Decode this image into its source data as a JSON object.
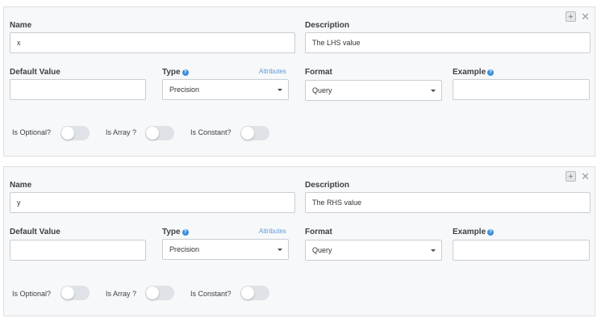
{
  "params": [
    {
      "name_label": "Name",
      "name_value": "x",
      "description_label": "Description",
      "description_value": "The LHS value",
      "default_value_label": "Default Value",
      "default_value": "",
      "type_label": "Type",
      "attributes_link": "Attributes",
      "type_value": "Precision",
      "format_label": "Format",
      "format_value": "Query",
      "example_label": "Example",
      "example_value": "",
      "is_optional_label": "Is Optional?",
      "is_array_label": "Is Array ?",
      "is_constant_label": "Is Constant?",
      "is_optional": false,
      "is_array": false,
      "is_constant": false
    },
    {
      "name_label": "Name",
      "name_value": "y",
      "description_label": "Description",
      "description_value": "The RHS value",
      "default_value_label": "Default Value",
      "default_value": "",
      "type_label": "Type",
      "attributes_link": "Attributes",
      "type_value": "Precision",
      "format_label": "Format",
      "format_value": "Query",
      "example_label": "Example",
      "example_value": "",
      "is_optional_label": "Is Optional?",
      "is_array_label": "Is Array ?",
      "is_constant_label": "Is Constant?",
      "is_optional": false,
      "is_array": false,
      "is_constant": false
    }
  ],
  "icons": {
    "add": "add-param-icon",
    "close": "close-icon",
    "help": "help-icon"
  },
  "colors": {
    "card_bg": "#f7f8f9",
    "help": "#3d8fd9",
    "link": "#5f9bd6",
    "toggle_off": "#dfe2e6"
  }
}
